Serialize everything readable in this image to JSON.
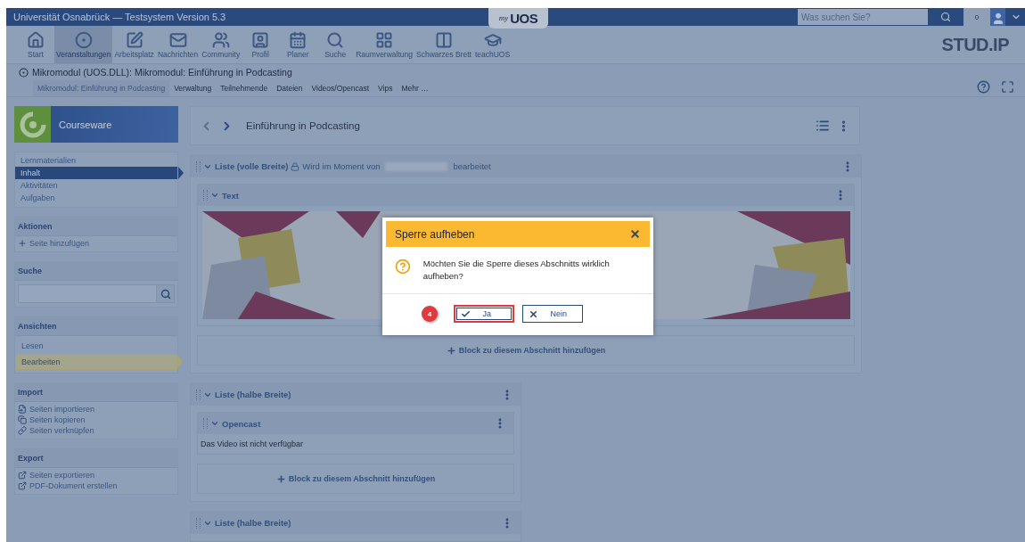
{
  "header": {
    "title": "Universität Osnabrück — Testsystem Version 5.3",
    "logo_tab": {
      "prefix": "my",
      "name": "UOS"
    },
    "search": {
      "placeholder": "Was suchen Sie?"
    },
    "notification_count": "0"
  },
  "nav": [
    {
      "label": "Start",
      "selected": false
    },
    {
      "label": "Veranstaltungen",
      "selected": true
    },
    {
      "label": "Arbeitsplatz",
      "selected": false
    },
    {
      "label": "Nachrichten",
      "selected": false
    },
    {
      "label": "Community",
      "selected": false
    },
    {
      "label": "Profil",
      "selected": false
    },
    {
      "label": "Planer",
      "selected": false
    },
    {
      "label": "Suche",
      "selected": false
    },
    {
      "label": "Raumverwaltung",
      "selected": false
    },
    {
      "label": "Schwarzes Brett",
      "selected": false
    },
    {
      "label": "teachUOS",
      "selected": false
    }
  ],
  "brand": "STUD.IP",
  "course": {
    "title": "Mikromodul (UOS.DLL): Mikromodul: Einführung in Podcasting",
    "tabs": [
      {
        "label": "Mikromodul: Einführung in Podcasting",
        "selected": true
      },
      {
        "label": "Verwaltung",
        "selected": false
      },
      {
        "label": "Teilnehmende",
        "selected": false
      },
      {
        "label": "Dateien",
        "selected": false
      },
      {
        "label": "Videos/Opencast",
        "selected": false
      },
      {
        "label": "Vips",
        "selected": false
      },
      {
        "label": "Mehr …",
        "selected": false
      }
    ]
  },
  "sidebar": {
    "title": "Courseware",
    "nav": [
      {
        "label": "Lernmaterialien",
        "selected": false
      },
      {
        "label": "Inhalt",
        "selected": true
      },
      {
        "label": "Aktivitäten",
        "selected": false
      },
      {
        "label": "Aufgaben",
        "selected": false
      }
    ],
    "widgets": [
      {
        "title": "Aktionen",
        "kind": "links",
        "items": [
          {
            "label": "Seite hinzufügen",
            "kind": "add"
          }
        ]
      },
      {
        "title": "Suche",
        "kind": "search"
      },
      {
        "title": "Ansichten",
        "kind": "views",
        "items": [
          {
            "label": "Lesen",
            "selected": false
          },
          {
            "label": "Bearbeiten",
            "selected": true
          }
        ]
      },
      {
        "title": "Import",
        "kind": "links",
        "items": [
          {
            "label": "Seiten importieren",
            "kind": "import"
          },
          {
            "label": "Seiten kopieren",
            "kind": "copy"
          },
          {
            "label": "Seiten verknüpfen",
            "kind": "link"
          }
        ]
      },
      {
        "title": "Export",
        "kind": "links",
        "items": [
          {
            "label": "Seiten exportieren",
            "kind": "export"
          },
          {
            "label": "PDF-Dokument erstellen",
            "kind": "export"
          }
        ]
      }
    ]
  },
  "page_title": "Einführung in Podcasting",
  "sections": [
    {
      "title": "Liste (volle Breite)",
      "kind": "full",
      "locked": true,
      "lock_before": "Wird im Moment von",
      "lock_after": "bearbeitet",
      "blocks": [
        {
          "title": "Text",
          "kind": "image"
        }
      ],
      "add_label": "Block zu diesem Abschnitt hinzufügen"
    },
    {
      "title": "Liste (halbe Breite)",
      "kind": "half",
      "locked": false,
      "blocks": [
        {
          "title": "Opencast",
          "kind": "message",
          "message": "Das Video ist nicht verfügbar"
        }
      ],
      "add_label": "Block zu diesem Abschnitt hinzufügen"
    },
    {
      "title": "Liste (halbe Breite)",
      "kind": "half",
      "locked": false
    }
  ],
  "dialog": {
    "title": "Sperre aufheben",
    "message": "Möchten Sie die Sperre dieses Abschnitts wirklich aufheben?",
    "step_badge": "4",
    "buttons": [
      {
        "label": "Ja",
        "kind": "confirm",
        "highlighted": true
      },
      {
        "label": "Nein",
        "kind": "cancel",
        "highlighted": false
      }
    ]
  }
}
